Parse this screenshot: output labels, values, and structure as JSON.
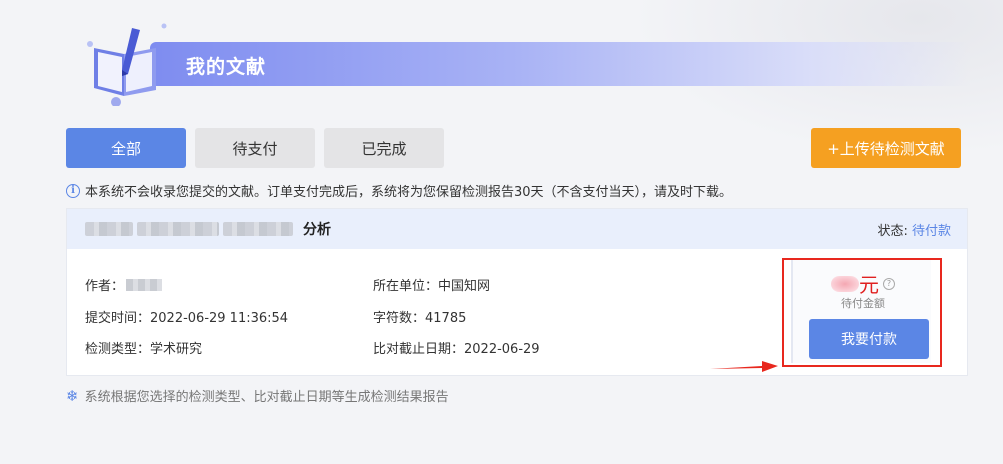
{
  "header": {
    "title": "我的文献"
  },
  "tabs": [
    {
      "label": "全部",
      "active": true
    },
    {
      "label": "待支付",
      "active": false
    },
    {
      "label": "已完成",
      "active": false
    }
  ],
  "upload_button": "+上传待检测文献",
  "notice": "本系统不会收录您提交的文献。订单支付完成后，系统将为您保留检测报告30天（不含支付当天），请及时下载。",
  "card": {
    "title_suffix": "分析",
    "status_label": "状态:",
    "status_value": "待付款",
    "author_label": "作者：",
    "submit_time": "提交时间：2022-06-29 11:36:54",
    "check_type": "检测类型：学术研究",
    "org": "所在单位：中国知网",
    "char_count": "字符数：41785",
    "deadline": "比对截止日期：2022-06-29"
  },
  "payment": {
    "amount_unit": "元",
    "amount_caption": "待付金额",
    "pay_button": "我要付款"
  },
  "footnote": "系统根据您选择的检测类型、比对截止日期等生成检测结果报告",
  "colors": {
    "primary": "#5b86e5",
    "upload": "#f5a021",
    "alert": "#e02020"
  }
}
